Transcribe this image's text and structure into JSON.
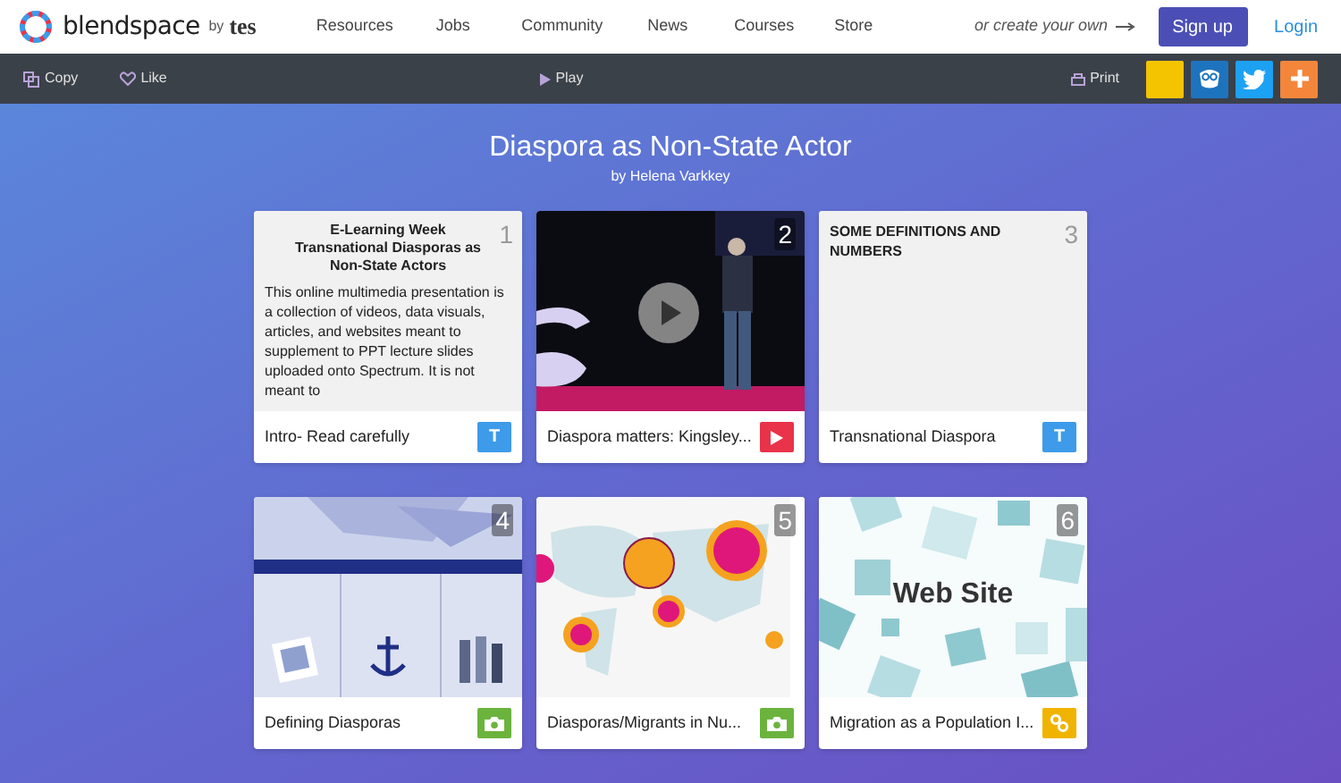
{
  "header": {
    "logo_text": "blendspace",
    "by": "by",
    "brand": "tes",
    "nav": [
      "Resources",
      "Jobs",
      "Community",
      "News",
      "Courses",
      "Store"
    ],
    "create_prompt": "or create your own",
    "signup": "Sign up",
    "login": "Login"
  },
  "toolbar": {
    "copy": "Copy",
    "like": "Like",
    "play": "Play",
    "print": "Print",
    "share": [
      {
        "kind": "blank",
        "color": "#f5c400"
      },
      {
        "kind": "owl",
        "color": "#1e73be"
      },
      {
        "kind": "bird",
        "color": "#1da1f2"
      },
      {
        "kind": "plus",
        "color": "#f4863b"
      }
    ]
  },
  "lesson": {
    "title": "Diaspora as Non-State Actor",
    "author": "by Helena Varkkey"
  },
  "cards": [
    {
      "number": "1",
      "kind": "text",
      "heading": "E-Learning Week Transnational Diasporas as Non-State Actors",
      "body": "This online multimedia presentation is a collection of videos, data visuals, articles, and websites meant to supplement to PPT lecture slides uploaded onto Spectrum. It is not meant to",
      "caption": "Intro- Read carefully",
      "badge": "T"
    },
    {
      "number": "2",
      "kind": "video",
      "caption": "Diaspora matters: Kingsley..."
    },
    {
      "number": "3",
      "kind": "text",
      "heading_left": "SOME DEFINITIONS AND NUMBERS",
      "caption": "Transnational Diaspora",
      "badge": "T"
    },
    {
      "number": "4",
      "caption": "Defining Diasporas"
    },
    {
      "number": "5",
      "caption": "Diasporas/Migrants in Nu..."
    },
    {
      "number": "6",
      "kind": "link",
      "preview_label": "Web Site",
      "caption": "Migration as a Population I..."
    }
  ]
}
